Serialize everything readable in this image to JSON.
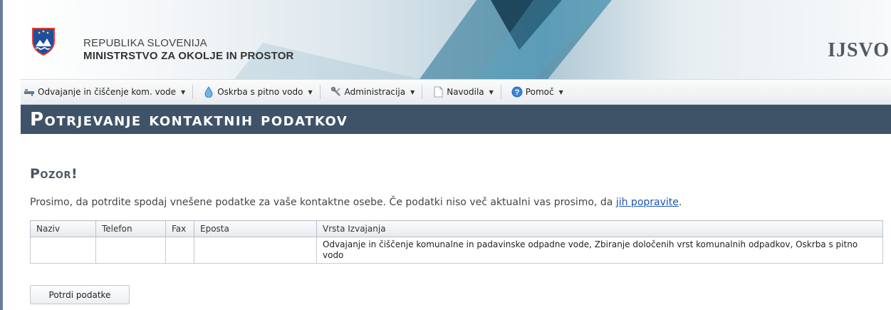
{
  "header": {
    "republika": "REPUBLIKA SLOVENIJA",
    "ministrstvo": "MINISTRSTVO ZA OKOLJE IN PROSTOR",
    "brand": "IJSVO"
  },
  "menu": {
    "items": [
      {
        "label": "Odvajanje in čiščenje kom. vode",
        "icon": "drain-pipe-icon"
      },
      {
        "label": "Oskrba s pitno vodo",
        "icon": "water-drop-icon"
      },
      {
        "label": "Administracija",
        "icon": "tools-icon"
      },
      {
        "label": "Navodila",
        "icon": "document-icon"
      },
      {
        "label": "Pomoč",
        "icon": "help-icon"
      }
    ]
  },
  "page": {
    "title": "Potrjevanje kontaktnih podatkov",
    "warning": "Pozor!",
    "message_before": "Prosimo, da potrdite spodaj vnešene podatke za vaše kontaktne osebe. Če podatki niso več aktualni vas prosimo, da ",
    "message_link": "jih popravite",
    "message_after": "."
  },
  "table": {
    "headers": [
      "Naziv",
      "Telefon",
      "Fax",
      "Eposta",
      "Vrsta Izvajanja"
    ],
    "rows": [
      [
        "",
        "",
        "",
        "",
        "Odvajanje in čiščenje komunalne in padavinske odpadne vode, Zbiranje določenih vrst komunalnih odpadkov, Oskrba s pitno vodo"
      ]
    ]
  },
  "buttons": {
    "confirm": "Potrdi podatke"
  },
  "colors": {
    "title_band": "#3e5367",
    "link": "#1a55b5"
  }
}
